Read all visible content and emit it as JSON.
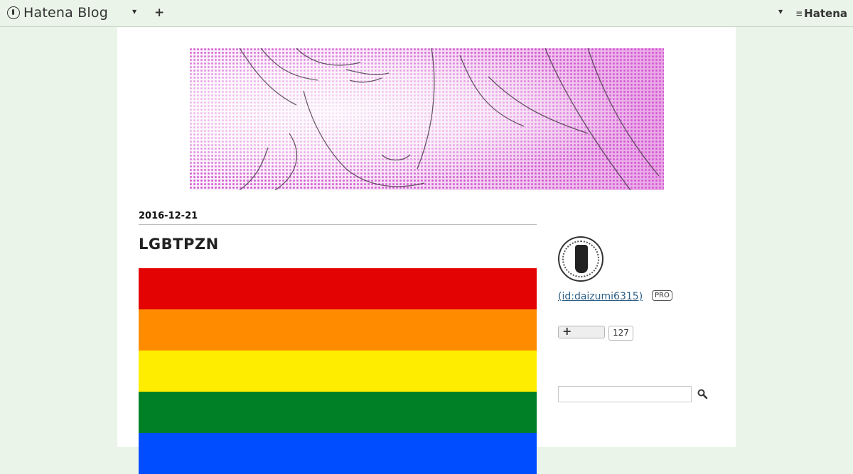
{
  "topbar": {
    "brand": "Hatena Blog",
    "add_label": "+",
    "hatena_label": "Hatena",
    "colors": {
      "background": "#ebf4e9"
    }
  },
  "entry": {
    "date": "2016-12-21",
    "title": "LGBTPZN",
    "flag_colors": [
      "#e40303",
      "#ff8c00",
      "#ffed00",
      "#008026",
      "#004dff"
    ]
  },
  "sidebar": {
    "user_link": " (id:daizumi6315)",
    "pro_badge": "PRO",
    "reader_button_icon": "plus-icon",
    "reader_count": "127",
    "search": {
      "value": "",
      "placeholder": ""
    },
    "search_icon": "magnifier-icon"
  }
}
